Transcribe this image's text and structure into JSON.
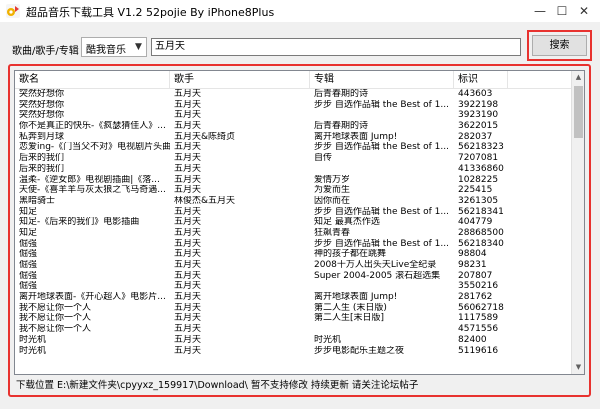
{
  "window": {
    "title": "超品音乐下载工具 V1.2 52pojie By iPhone8Plus",
    "min_glyph": "—",
    "max_glyph": "☐",
    "close_glyph": "✕",
    "icon": "music-app-icon"
  },
  "search": {
    "label": "歌曲/歌手/专辑",
    "source_selected": "酷我音乐",
    "keyword": "五月天",
    "button_label": "搜索"
  },
  "table": {
    "columns": [
      "歌名",
      "歌手",
      "专辑",
      "标识"
    ],
    "rows": [
      [
        "突然好想你",
        "五月天",
        "后青春期的诗",
        "443603"
      ],
      [
        "突然好想你",
        "五月天",
        "步步 自选作品辑 the Best of 1...",
        "3922198"
      ],
      [
        "突然好想你",
        "五月天",
        "",
        "3923190"
      ],
      [
        "你不是真正的快乐-《疯瑟猜佳人》...",
        "五月天",
        "后青春期的诗",
        "3622015"
      ],
      [
        "私奔到月球",
        "五月天&陈绮贞",
        "离开地球表面 Jump!",
        "282037"
      ],
      [
        "恋爱ing-《门当父不对》电视剧片头曲",
        "五月天",
        "步步 自选作品辑 the Best of 1...",
        "56218323"
      ],
      [
        "后来的我们",
        "五月天",
        "自传",
        "7207081"
      ],
      [
        "后来的我们",
        "五月天",
        "",
        "41336860"
      ],
      [
        "温柔-《逆女郎》电视剧插曲|《落...",
        "五月天",
        "爱情万岁",
        "1028225"
      ],
      [
        "天使-《喜羊羊与灰太狼之飞马奇遇...",
        "五月天",
        "为爱而生",
        "225415"
      ],
      [
        "黑暗骑士",
        "林俊杰&五月天",
        "因你而在",
        "3261305"
      ],
      [
        "知足",
        "五月天",
        "步步 自选作品辑 the Best of 1...",
        "56218341"
      ],
      [
        "知足-《后来的我们》电影插曲",
        "五月天",
        "知足 最真杰作选",
        "404779"
      ],
      [
        "知足",
        "五月天",
        "狂飙青春",
        "28868500"
      ],
      [
        "倔强",
        "五月天",
        "步步 自选作品辑 the Best of 1...",
        "56218340"
      ],
      [
        "倔强",
        "五月天",
        "神的孩子都在跳舞",
        "98804"
      ],
      [
        "倔强",
        "五月天",
        "2008十万人出头天Live全纪录",
        "98231"
      ],
      [
        "倔强",
        "五月天",
        "Super 2004-2005 滚石超选集",
        "207807"
      ],
      [
        "倔强",
        "五月天",
        "",
        "3550216"
      ],
      [
        "离开地球表面-《开心超人》电影片...",
        "五月天",
        "离开地球表面 Jump!",
        "281762"
      ],
      [
        "我不愿让你一个人",
        "五月天",
        "第二人生 (末日版)",
        "56062718"
      ],
      [
        "我不愿让你一个人",
        "五月天",
        "第二人生[末日版]",
        "1117589"
      ],
      [
        "我不愿让你一个人",
        "五月天",
        "",
        "4571556"
      ],
      [
        "时光机",
        "五月天",
        "时光机",
        "82400"
      ],
      [
        "时光机",
        "五月天",
        "步步电影配乐主题之夜",
        "5119616"
      ]
    ]
  },
  "status": {
    "text": "下载位置 E:\\新建文件夹\\cpyyxz_159917\\Download\\ 暂不支持修改 持续更新 请关注论坛帖子"
  },
  "colors": {
    "highlight_frame": "#e8322f",
    "window_bg": "#f0f0f0"
  }
}
